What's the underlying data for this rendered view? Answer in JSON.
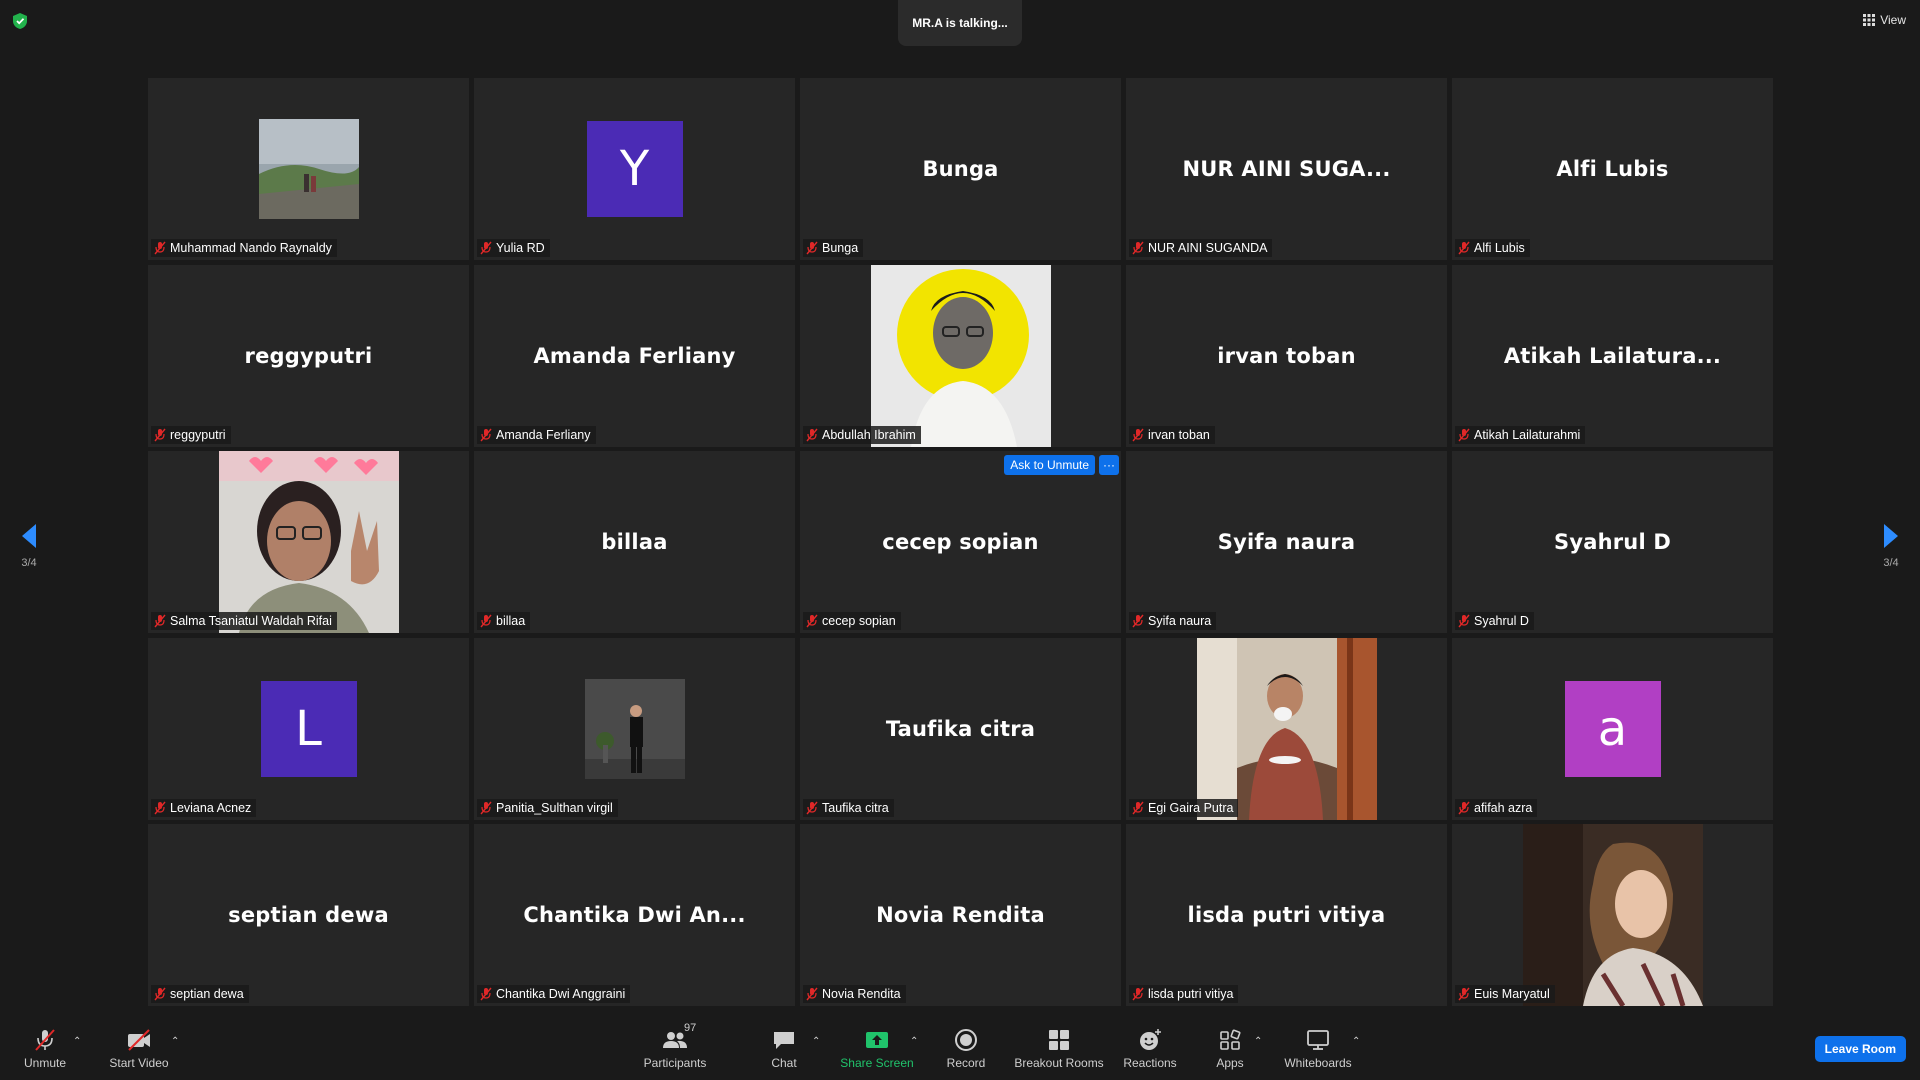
{
  "status": {
    "talking": "MR.A is talking..."
  },
  "view_label": "View",
  "pages": {
    "left": "3/4",
    "right": "3/4"
  },
  "tiles": [
    {
      "big": "",
      "name": "Muhammad Nando Raynaldy"
    },
    {
      "big": "Y",
      "name": "Yulia RD",
      "avatar_color": "#4b2bb5"
    },
    {
      "big": "Bunga",
      "name": "Bunga"
    },
    {
      "big": "NUR  AINI  SUGA...",
      "name": "NUR AINI SUGANDA"
    },
    {
      "big": "Alfi Lubis",
      "name": "Alfi Lubis"
    },
    {
      "big": "reggyputri",
      "name": "reggyputri"
    },
    {
      "big": "Amanda Ferliany",
      "name": "Amanda Ferliany"
    },
    {
      "big": "",
      "name": "Abdullah Ibrahim"
    },
    {
      "big": "irvan toban",
      "name": "irvan toban"
    },
    {
      "big": "Atikah  Lailatura...",
      "name": "Atikah Lailaturahmi"
    },
    {
      "big": "",
      "name": "Salma Tsaniatul Waldah Rifai"
    },
    {
      "big": "billaa",
      "name": "billaa"
    },
    {
      "big": "cecep sopian",
      "name": "cecep sopian",
      "ask_unmute": "Ask to Unmute",
      "more": "···"
    },
    {
      "big": "Syifa naura",
      "name": "Syifa naura"
    },
    {
      "big": "Syahrul D",
      "name": "Syahrul D"
    },
    {
      "big": "L",
      "name": "Leviana Acnez",
      "avatar_color": "#4b2bb5"
    },
    {
      "big": "",
      "name": "Panitia_Sulthan virgil"
    },
    {
      "big": "Taufika citra",
      "name": "Taufika citra"
    },
    {
      "big": "",
      "name": "Egi Gaira Putra"
    },
    {
      "big": "a",
      "name": "afifah azra",
      "avatar_color": "#b13fc4"
    },
    {
      "big": "septian dewa",
      "name": "septian dewa"
    },
    {
      "big": "Chantika  Dwi  An...",
      "name": "Chantika Dwi Anggraini"
    },
    {
      "big": "Novia Rendita",
      "name": "Novia Rendita"
    },
    {
      "big": "lisda putri vitiya",
      "name": "lisda putri vitiya"
    },
    {
      "big": "",
      "name": "Euis Maryatul"
    }
  ],
  "toolbar": {
    "unmute": "Unmute",
    "start_video": "Start Video",
    "participants": "Participants",
    "participants_count": "97",
    "chat": "Chat",
    "share_screen": "Share Screen",
    "record": "Record",
    "breakout_rooms": "Breakout Rooms",
    "reactions": "Reactions",
    "apps": "Apps",
    "whiteboards": "Whiteboards",
    "leave": "Leave Room"
  },
  "colors": {
    "background": "#1a1a1a",
    "tile": "#262626",
    "accent_blue": "#0e71eb",
    "share_green": "#20c36b",
    "muted_red": "#e02828"
  }
}
